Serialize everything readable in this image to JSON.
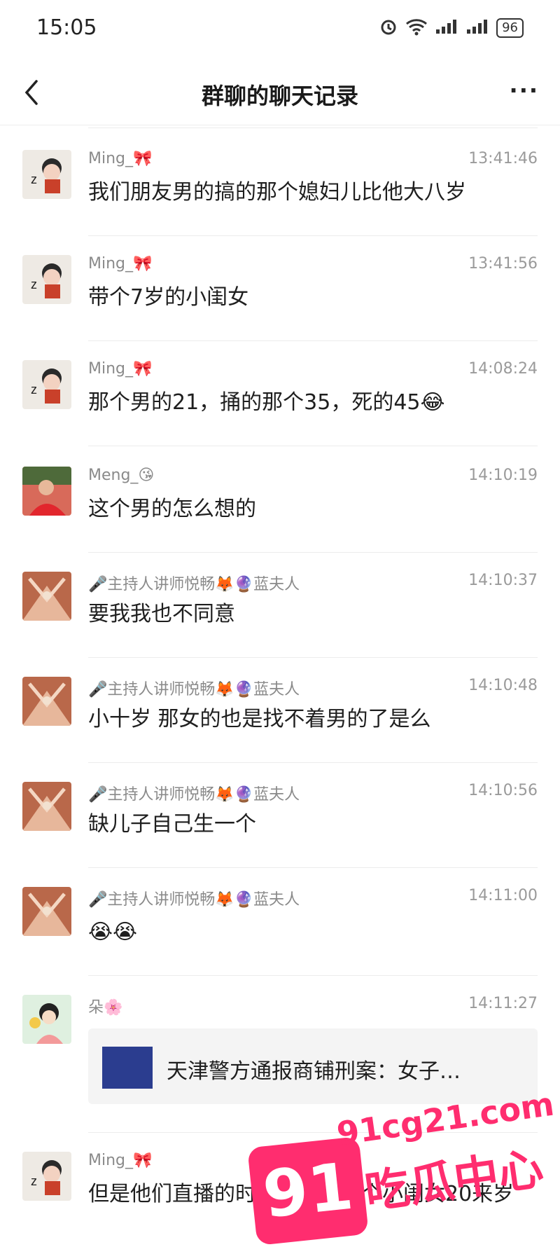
{
  "status_bar": {
    "time": "15:05",
    "battery": "96"
  },
  "header": {
    "title": "群聊的聊天记录",
    "more": "···"
  },
  "messages": [
    {
      "name": "Ming_🎀",
      "time": "13:41:46",
      "text": "我们朋友男的搞的那个媳妇儿比他大八岁",
      "avatar": "avatar-ming"
    },
    {
      "name": "Ming_🎀",
      "time": "13:41:56",
      "text": "带个7岁的小闺女",
      "avatar": "avatar-ming"
    },
    {
      "name": "Ming_🎀",
      "time": "14:08:24",
      "text": "那个男的21，捅的那个35，死的45😂",
      "avatar": "avatar-ming"
    },
    {
      "name": "Meng_😘",
      "time": "14:10:19",
      "text": "这个男的怎么想的",
      "avatar": "avatar-meng"
    },
    {
      "name": "🎤主持人讲师悦畅🦊🔮蓝夫人",
      "time": "14:10:37",
      "text": "要我我也不同意",
      "avatar": "avatar-host"
    },
    {
      "name": "🎤主持人讲师悦畅🦊🔮蓝夫人",
      "time": "14:10:48",
      "text": "小十岁 那女的也是找不着男的了是么",
      "avatar": "avatar-host"
    },
    {
      "name": "🎤主持人讲师悦畅🦊🔮蓝夫人",
      "time": "14:10:56",
      "text": "缺儿子自己生一个",
      "avatar": "avatar-host"
    },
    {
      "name": "🎤主持人讲师悦畅🦊🔮蓝夫人",
      "time": "14:11:00",
      "text": "😭😭",
      "avatar": "avatar-host"
    },
    {
      "name": "朵🌸",
      "time": "14:11:27",
      "card_title": "天津警方通报商铺刑案：女子…",
      "avatar": "avatar-duo"
    },
    {
      "name": "Ming_🎀",
      "time": "",
      "text": "但是他们直播的时候说了，这个小闺女20来岁",
      "avatar": "avatar-ming"
    }
  ],
  "watermark": {
    "badge": "91",
    "url": "91cg21.com",
    "brand": "吃瓜中心"
  },
  "colors": {
    "accent": "#ff2d6f",
    "card_thumb": "#2b3d8f"
  }
}
